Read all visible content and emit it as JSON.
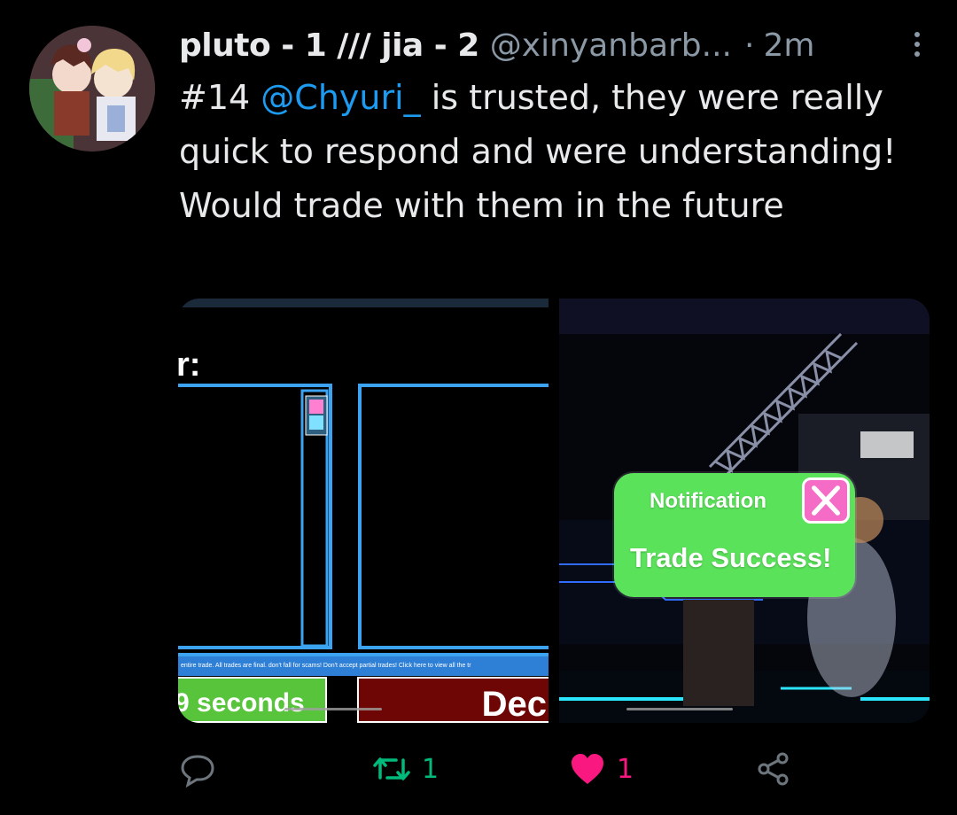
{
  "tweet": {
    "display_name": "pluto - 1 /// jia - 2",
    "handle": "@xinyanbarb...",
    "separator": "·",
    "time": "2m",
    "text_before": "#14 ",
    "mention": "@Chyuri_",
    "text_after": "  is trusted, they were really quick to respond and were understanding! Would trade with them in the future"
  },
  "media": {
    "left_image": {
      "trade_label": "r:",
      "disclaimer": "entire trade. All trades are final. don't fall for scams! Don't accept partial trades! Click here to view all the tr",
      "timer_button": "9 seconds",
      "decline_button": "Dec"
    },
    "right_image": {
      "notification_title": "Notification",
      "notification_message": "Trade Success!"
    }
  },
  "actions": {
    "reply_icon": "reply-icon",
    "retweet_icon": "retweet-icon",
    "retweet_count": "1",
    "like_icon": "heart-icon",
    "like_count": "1",
    "share_icon": "share-icon"
  },
  "colors": {
    "background": "#000000",
    "text": "#e7e9ea",
    "muted": "#8b98a5",
    "mention": "#1d9bf0",
    "retweet": "#00ba7c",
    "like": "#f91880",
    "notification_green": "#5be25b",
    "close_pink": "#f46cc5"
  }
}
